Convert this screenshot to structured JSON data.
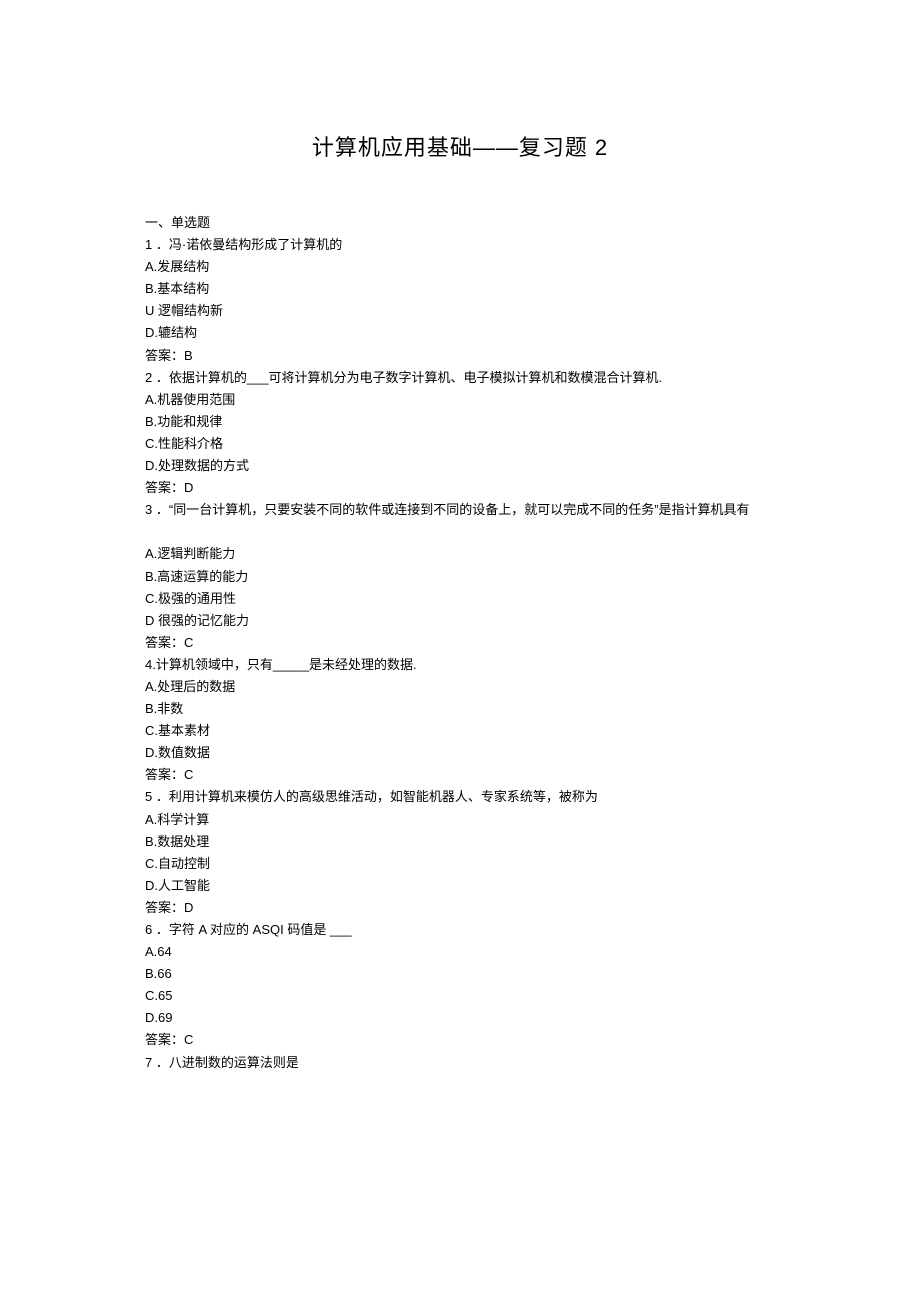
{
  "title": "计算机应用基础——复习题 2",
  "section": "一、单选题",
  "questions": [
    {
      "num": "1",
      "stem": "．冯·诺依曼结构形成了计算机的",
      "options": [
        "A.发展结构",
        "B.基本结构",
        "U 逻帽结构新",
        "D.辘结构"
      ],
      "answer": "答案：B"
    },
    {
      "num": "2",
      "stem": "．依据计算机的___可将计算机分为电子数字计算机、电子模拟计算机和数模混合计算机.",
      "options": [
        "A.机器使用范围",
        "B.功能和规律",
        "C.性能科介格",
        "D.处理数据的方式"
      ],
      "answer": "答案：D"
    },
    {
      "num": "3",
      "stem": "．“同一台计算机，只要安装不同的软件或连接到不同的设备上，就可以完成不同的任务”是指计算机具有",
      "options": [
        "A.逻辑判断能力",
        "B.高速运算的能力",
        "C.极强的通用性",
        "D 很强的记忆能力"
      ],
      "answer": "答案：C",
      "extraGap": true
    },
    {
      "num": "4",
      "stem": "4.计算机领域中，只有_____是未经处理的数据.",
      "noNumPrefix": true,
      "options": [
        "A.处理后的数据",
        "B.非数",
        "C.基本素材",
        "D.数值数据"
      ],
      "answer": "答案：C"
    },
    {
      "num": "5",
      "stem": "．利用计算机来模仿人的高级思维活动，如智能机器人、专家系统等，被称为",
      "options": [
        "A.科学计算",
        "B.数据处理",
        "C.自动控制",
        "D.人工智能"
      ],
      "answer": "答案：D"
    },
    {
      "num": "6",
      "stem": "．字符 A 对应的 ASQI 码值是 ___",
      "options": [
        "A.64",
        "B.66",
        "C.65",
        "D.69"
      ],
      "answer": "答案：C"
    },
    {
      "num": "7",
      "stem": "．八进制数的运算法则是",
      "options": [],
      "answer": ""
    }
  ]
}
